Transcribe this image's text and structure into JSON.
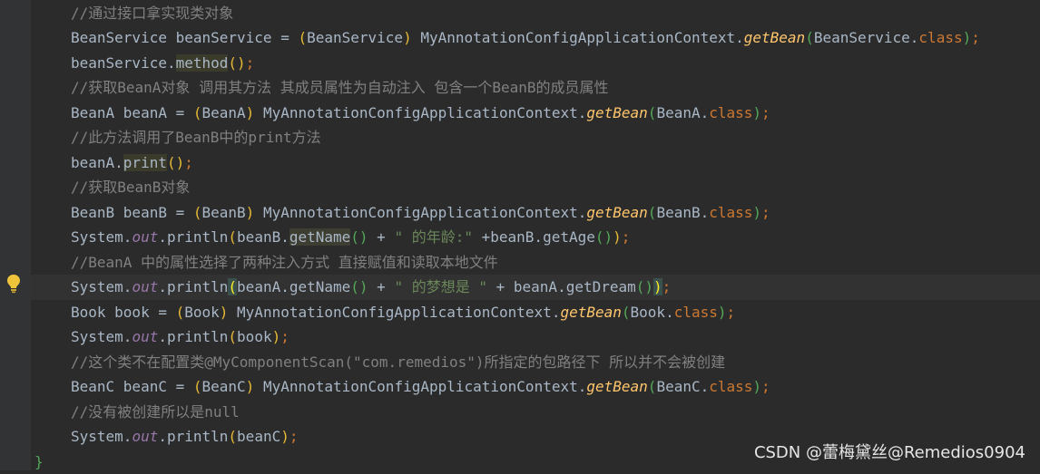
{
  "editor": {
    "colors": {
      "background": "#2b2b2b",
      "comment": "#808080",
      "plain": "#a9b7c6",
      "keyword": "#cc7832",
      "string": "#6a8759",
      "method": "#ffc66d",
      "field": "#9876aa",
      "paren": "#e8ba36"
    },
    "lines": [
      {
        "tokens": [
          {
            "t": "//通过接口拿实现类对象",
            "c": "comment"
          }
        ]
      },
      {
        "tokens": [
          {
            "t": "BeanService beanService = ",
            "c": "plain"
          },
          {
            "t": "(",
            "c": "paren"
          },
          {
            "t": "BeanService",
            "c": "plain"
          },
          {
            "t": ")",
            "c": "paren"
          },
          {
            "t": " MyAnnotationConfigApplicationContext.",
            "c": "plain"
          },
          {
            "t": "getBean",
            "c": "method-i"
          },
          {
            "t": "(",
            "c": "paren2"
          },
          {
            "t": "BeanService.",
            "c": "plain"
          },
          {
            "t": "class",
            "c": "kw"
          },
          {
            "t": ")",
            "c": "paren2"
          },
          {
            "t": ";",
            "c": "kw"
          }
        ]
      },
      {
        "tokens": [
          {
            "t": "beanService.",
            "c": "plain"
          },
          {
            "t": "method",
            "c": "plain",
            "hl": "usage"
          },
          {
            "t": "()",
            "c": "paren"
          },
          {
            "t": ";",
            "c": "kw"
          }
        ]
      },
      {
        "tokens": [
          {
            "t": "//获取BeanA对象 调用其方法 其成员属性为自动注入 包含一个BeanB的成员属性",
            "c": "comment"
          }
        ]
      },
      {
        "tokens": [
          {
            "t": "BeanA beanA = ",
            "c": "plain"
          },
          {
            "t": "(",
            "c": "paren"
          },
          {
            "t": "BeanA",
            "c": "plain"
          },
          {
            "t": ")",
            "c": "paren"
          },
          {
            "t": " MyAnnotationConfigApplicationContext.",
            "c": "plain"
          },
          {
            "t": "getBean",
            "c": "method-i"
          },
          {
            "t": "(",
            "c": "paren2"
          },
          {
            "t": "BeanA.",
            "c": "plain"
          },
          {
            "t": "class",
            "c": "kw"
          },
          {
            "t": ")",
            "c": "paren2"
          },
          {
            "t": ";",
            "c": "kw"
          }
        ]
      },
      {
        "tokens": [
          {
            "t": "//此方法调用了BeanB中的print方法",
            "c": "comment"
          }
        ]
      },
      {
        "tokens": [
          {
            "t": "beanA.",
            "c": "plain"
          },
          {
            "t": "print",
            "c": "plain",
            "hl": "usage"
          },
          {
            "t": "()",
            "c": "paren"
          },
          {
            "t": ";",
            "c": "kw"
          }
        ]
      },
      {
        "tokens": [
          {
            "t": "//获取BeanB对象",
            "c": "comment"
          }
        ]
      },
      {
        "tokens": [
          {
            "t": "BeanB beanB = ",
            "c": "plain"
          },
          {
            "t": "(",
            "c": "paren"
          },
          {
            "t": "BeanB",
            "c": "plain"
          },
          {
            "t": ")",
            "c": "paren"
          },
          {
            "t": " MyAnnotationConfigApplicationContext.",
            "c": "plain"
          },
          {
            "t": "getBean",
            "c": "method-i"
          },
          {
            "t": "(",
            "c": "paren2"
          },
          {
            "t": "BeanB.",
            "c": "plain"
          },
          {
            "t": "class",
            "c": "kw"
          },
          {
            "t": ")",
            "c": "paren2"
          },
          {
            "t": ";",
            "c": "kw"
          }
        ]
      },
      {
        "tokens": [
          {
            "t": "System.",
            "c": "plain"
          },
          {
            "t": "out",
            "c": "field-i"
          },
          {
            "t": ".println",
            "c": "plain"
          },
          {
            "t": "(",
            "c": "paren"
          },
          {
            "t": "beanB.",
            "c": "plain"
          },
          {
            "t": "getName",
            "c": "plain",
            "hl": "usage2"
          },
          {
            "t": "()",
            "c": "paren2"
          },
          {
            "t": " + ",
            "c": "plain"
          },
          {
            "t": "\" 的年龄:\"",
            "c": "str"
          },
          {
            "t": " +beanB.getAge",
            "c": "plain"
          },
          {
            "t": "()",
            "c": "paren2"
          },
          {
            "t": ")",
            "c": "paren"
          },
          {
            "t": ";",
            "c": "kw"
          }
        ]
      },
      {
        "tokens": [
          {
            "t": "//BeanA 中的属性选择了两种注入方式 直接赋值和读取本地文件",
            "c": "comment"
          }
        ]
      },
      {
        "current": true,
        "tokens": [
          {
            "t": "System.",
            "c": "plain"
          },
          {
            "t": "out",
            "c": "field-i"
          },
          {
            "t": ".println",
            "c": "plain"
          },
          {
            "t": "(",
            "c": "paren",
            "hl": "brace"
          },
          {
            "t": "beanA.getName",
            "c": "plain"
          },
          {
            "t": "()",
            "c": "paren2"
          },
          {
            "t": " + ",
            "c": "plain"
          },
          {
            "t": "\" 的梦想是 \"",
            "c": "str"
          },
          {
            "t": " + beanA.getDream",
            "c": "plain"
          },
          {
            "t": "()",
            "c": "paren2"
          },
          {
            "t": ")",
            "c": "paren",
            "hl": "brace"
          },
          {
            "t": ";",
            "c": "kw"
          }
        ]
      },
      {
        "tokens": [
          {
            "t": "Book book = ",
            "c": "plain"
          },
          {
            "t": "(",
            "c": "paren"
          },
          {
            "t": "Book",
            "c": "plain"
          },
          {
            "t": ")",
            "c": "paren"
          },
          {
            "t": " MyAnnotationConfigApplicationContext.",
            "c": "plain"
          },
          {
            "t": "getBean",
            "c": "method-i"
          },
          {
            "t": "(",
            "c": "paren2"
          },
          {
            "t": "Book.",
            "c": "plain"
          },
          {
            "t": "class",
            "c": "kw"
          },
          {
            "t": ")",
            "c": "paren2"
          },
          {
            "t": ";",
            "c": "kw"
          }
        ]
      },
      {
        "tokens": [
          {
            "t": "System.",
            "c": "plain"
          },
          {
            "t": "out",
            "c": "field-i"
          },
          {
            "t": ".println",
            "c": "plain"
          },
          {
            "t": "(",
            "c": "paren"
          },
          {
            "t": "book",
            "c": "plain"
          },
          {
            "t": ")",
            "c": "paren"
          },
          {
            "t": ";",
            "c": "kw"
          }
        ]
      },
      {
        "tokens": [
          {
            "t": "//这个类不在配置类@MyComponentScan(\"com.remedios\")所指定的包路径下 所以并不会被创建",
            "c": "comment"
          }
        ]
      },
      {
        "tokens": [
          {
            "t": "BeanC beanC = ",
            "c": "plain"
          },
          {
            "t": "(",
            "c": "paren"
          },
          {
            "t": "BeanC",
            "c": "plain"
          },
          {
            "t": ")",
            "c": "paren"
          },
          {
            "t": " MyAnnotationConfigApplicationContext.",
            "c": "plain"
          },
          {
            "t": "getBean",
            "c": "method-i"
          },
          {
            "t": "(",
            "c": "paren2"
          },
          {
            "t": "BeanC.",
            "c": "plain"
          },
          {
            "t": "class",
            "c": "kw"
          },
          {
            "t": ")",
            "c": "paren2"
          },
          {
            "t": ";",
            "c": "kw"
          }
        ]
      },
      {
        "tokens": [
          {
            "t": "//没有被创建所以是null",
            "c": "comment"
          }
        ]
      },
      {
        "tokens": [
          {
            "t": "System.",
            "c": "plain"
          },
          {
            "t": "out",
            "c": "field-i"
          },
          {
            "t": ".println",
            "c": "plain"
          },
          {
            "t": "(",
            "c": "paren"
          },
          {
            "t": "beanC",
            "c": "plain"
          },
          {
            "t": ")",
            "c": "paren"
          },
          {
            "t": ";",
            "c": "kw"
          }
        ]
      },
      {
        "brace": true,
        "tokens": [
          {
            "t": "}",
            "c": "paren2"
          }
        ]
      }
    ],
    "gutter_icon": "lightbulb-icon"
  },
  "watermark": {
    "text": "CSDN @蕾梅黛丝@Remedios0904"
  }
}
